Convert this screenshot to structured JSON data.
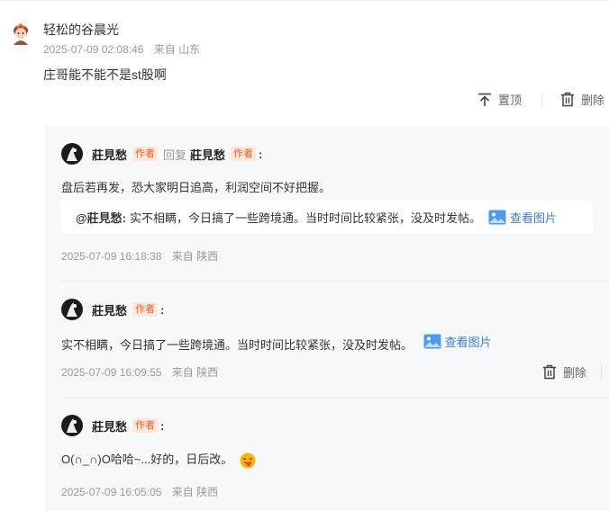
{
  "comment": {
    "username": "轻松的谷晨光",
    "time": "2025-07-09 02:08:46",
    "location": "来自 山东",
    "content": "庄哥能不能不是st股啊",
    "pin_label": "置顶",
    "delete_label": "删除"
  },
  "replies": [
    {
      "author": "莊見愁",
      "tag": "作者",
      "reply_text": "回复",
      "reply_to": "莊見愁",
      "reply_to_tag": "作者",
      "content": "盘后若再发，恐大家明日追高，利润空间不好把握。",
      "quote_name": "@莊見愁:",
      "quote_text": "实不相瞒，今日搞了一些跨境通。当时时间比较紧张，没及时发帖。",
      "image_link": "查看图片",
      "time": "2025-07-09 16:18:38",
      "location": "来自 陕西"
    },
    {
      "author": "莊見愁",
      "tag": "作者",
      "content": "实不相瞒，今日搞了一些跨境通。当时时间比较紧张，没及时发帖。",
      "image_link": "查看图片",
      "time": "2025-07-09 16:09:55",
      "location": "来自 陕西",
      "delete_label": "删除"
    },
    {
      "author": "莊見愁",
      "tag": "作者",
      "content": "O(∩_∩)O哈哈~...好的，日后改。",
      "time": "2025-07-09 16:05:05",
      "location": "来自 陕西"
    }
  ],
  "colors": {
    "tag": "#f25c1c",
    "link": "#3f7bd6",
    "meta": "#999999",
    "panel": "#f7f8fa"
  }
}
